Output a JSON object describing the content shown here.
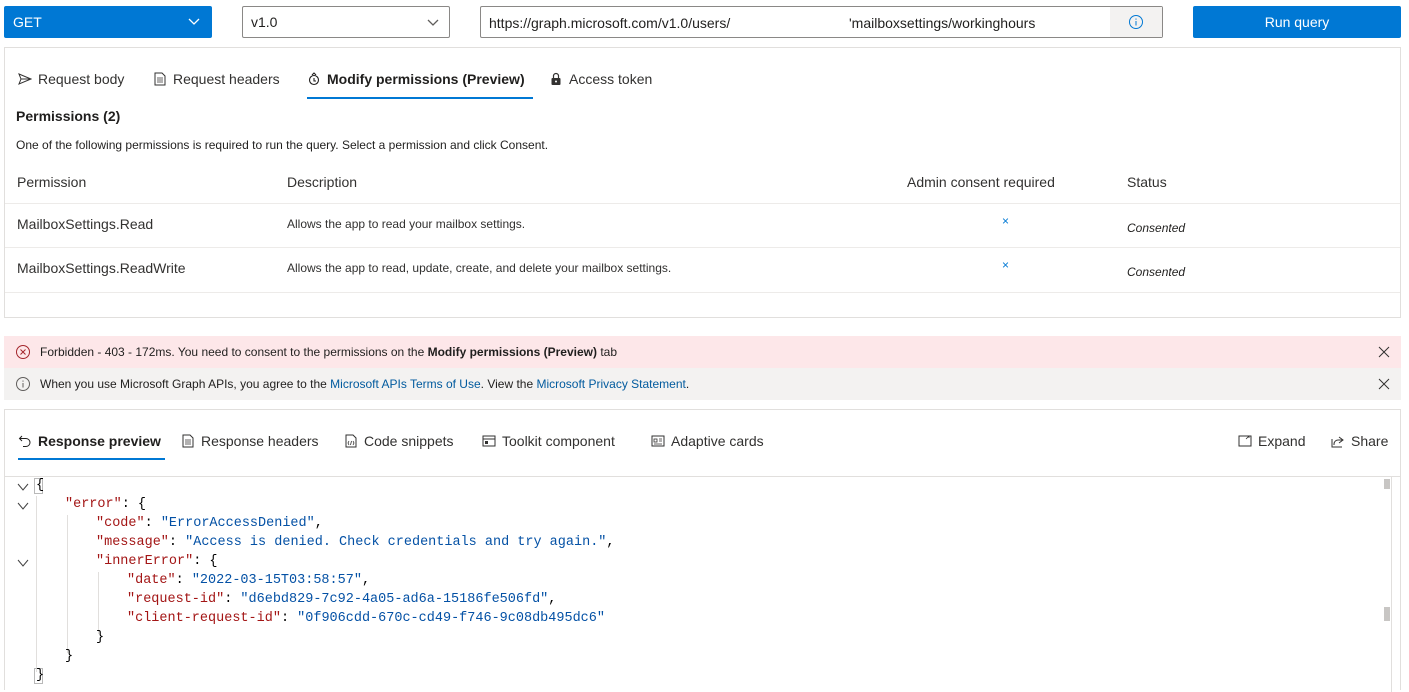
{
  "query": {
    "method": "GET",
    "version": "v1.0",
    "url_prefix": "https://graph.microsoft.com/v1.0/users/",
    "url_suffix": "'mailboxsettings/workinghours",
    "run_label": "Run query"
  },
  "request_tabs": [
    {
      "label": "Request body",
      "icon": "send-icon"
    },
    {
      "label": "Request headers",
      "icon": "document-icon"
    },
    {
      "label": "Modify permissions (Preview)",
      "icon": "key-icon",
      "selected": true
    },
    {
      "label": "Access token",
      "icon": "lock-icon"
    }
  ],
  "permissions": {
    "title": "Permissions (2)",
    "description": "One of the following permissions is required to run the query. Select a permission and click Consent.",
    "columns": [
      "Permission",
      "Description",
      "Admin consent required",
      "Status"
    ],
    "rows": [
      {
        "name": "MailboxSettings.Read",
        "description": "Allows the app to read your mailbox settings.",
        "admin": "×",
        "status": "Consented"
      },
      {
        "name": "MailboxSettings.ReadWrite",
        "description": "Allows the app to read, update, create, and delete your mailbox settings.",
        "admin": "×",
        "status": "Consented"
      }
    ]
  },
  "messages": {
    "error": {
      "prefix": "Forbidden - 403 - 172ms. You need to consent to the permissions on the ",
      "bold": "Modify permissions (Preview)",
      "suffix": " tab"
    },
    "info": {
      "prefix": "When you use Microsoft Graph APIs, you agree to the ",
      "link1": "Microsoft APIs Terms of Use",
      "middle": ". View the ",
      "link2": "Microsoft Privacy Statement",
      "suffix": "."
    }
  },
  "response_tabs": [
    {
      "label": "Response preview",
      "icon": "undo-icon",
      "selected": true
    },
    {
      "label": "Response headers",
      "icon": "document-icon"
    },
    {
      "label": "Code snippets",
      "icon": "code-icon"
    },
    {
      "label": "Toolkit component",
      "icon": "toolkit-icon"
    },
    {
      "label": "Adaptive cards",
      "icon": "card-icon"
    }
  ],
  "response_actions": [
    {
      "label": "Expand",
      "icon": "expand-icon"
    },
    {
      "label": "Share",
      "icon": "share-icon"
    }
  ],
  "response_json": {
    "open_brace": "{",
    "error_key": "\"error\"",
    "code_key": "\"code\"",
    "code_val": "\"ErrorAccessDenied\"",
    "message_key": "\"message\"",
    "message_val": "\"Access is denied. Check credentials and try again.\"",
    "inner_key": "\"innerError\"",
    "date_key": "\"date\"",
    "date_val": "\"2022-03-15T03:58:57\"",
    "request_id_key": "\"request-id\"",
    "request_id_val": "\"d6ebd829-7c92-4a05-ad6a-15186fe506fd\"",
    "client_request_id_key": "\"client-request-id\"",
    "client_request_id_val": "\"0f906cdd-670c-cd49-f746-9c08db495dc6\"",
    "close_inner": "}",
    "close_error": "}",
    "close_brace": "}"
  },
  "colors": {
    "accent": "#0078d4",
    "error_bg": "#fde7e9",
    "info_bg": "#f3f2f1",
    "json_key": "#a31515",
    "json_value": "#0451a5"
  }
}
